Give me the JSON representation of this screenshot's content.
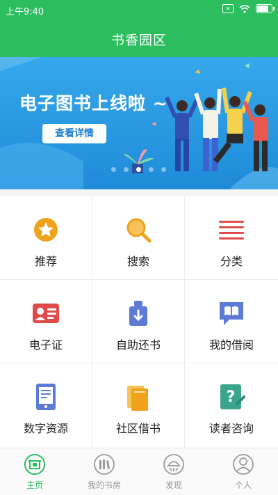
{
  "status_bar": {
    "time": "上午9:40",
    "battery_percent": 80
  },
  "header": {
    "title": "书香园区"
  },
  "banner": {
    "headline": "电子图书上线啦 ~",
    "cta_label": "查看详情",
    "page_count": 5,
    "active_page": 2
  },
  "grid": {
    "items": [
      {
        "label": "推荐",
        "icon": "star-icon",
        "color": "#f0a21a"
      },
      {
        "label": "搜索",
        "icon": "search-icon",
        "color": "#f0a21a"
      },
      {
        "label": "分类",
        "icon": "list-icon",
        "color": "#e04a4a"
      },
      {
        "label": "电子证",
        "icon": "id-card-icon",
        "color": "#e04a4a"
      },
      {
        "label": "自助还书",
        "icon": "return-book-icon",
        "color": "#5d7bd6"
      },
      {
        "label": "我的借阅",
        "icon": "book-chat-icon",
        "color": "#5d7bd6"
      },
      {
        "label": "数字资源",
        "icon": "tablet-icon",
        "color": "#5d7bd6"
      },
      {
        "label": "社区借书",
        "icon": "books-icon",
        "color": "#f0a21a"
      },
      {
        "label": "读者咨询",
        "icon": "question-note-icon",
        "color": "#3aa58c"
      }
    ]
  },
  "bottom_nav": {
    "tabs": [
      {
        "label": "主页",
        "icon": "home-icon",
        "active": true
      },
      {
        "label": "我的书房",
        "icon": "bookshelf-icon",
        "active": false
      },
      {
        "label": "发现",
        "icon": "discover-icon",
        "active": false
      },
      {
        "label": "个人",
        "icon": "person-icon",
        "active": false
      }
    ],
    "active_color": "#2bbd5e",
    "inactive_color": "#9a9a9a"
  }
}
